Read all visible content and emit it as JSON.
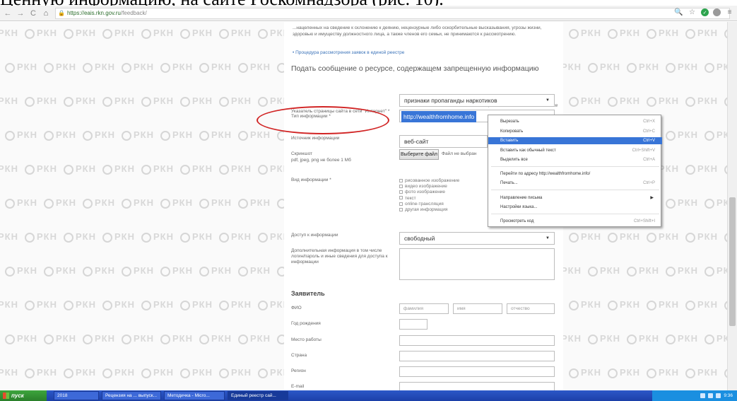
{
  "caption": "Ценную информацию, на сайте Роскомнадзора (рис. 10).",
  "browser": {
    "url_host": "https://eais.rkn.gov.ru",
    "url_path": "/feedback/",
    "back": "←",
    "forward": "→",
    "reload": "C",
    "home": "⌂"
  },
  "watermark": "РКН",
  "form": {
    "intro": "...нацеленных на сведение к склонению к деянию, нецензурные либо оскорбительные высказывания, угрозы жизни, здоровью и имуществу должностного лица, а также членов его семьи, не принимаются к рассмотрению.",
    "procedure_link": "Процедура рассмотрения заявок в единой реестре",
    "section_title": "Подать сообщение о ресурсе, содержащем запрещенную информацию",
    "required_note": "* - поля, обязательные для заполнения",
    "info_type_label": "Тип информации *",
    "info_type_value": "признаки пропаганды наркотиков",
    "url_label": "Указатель страницы сайта в сети \"Интернет\" *",
    "url_value": "http://wealthfromhome.info",
    "source_label": "Источник информации",
    "source_value": "веб-сайт",
    "screenshot_label": "Скриншот",
    "screenshot_hint": "pdf, jpeg, png не более 1 Мб",
    "file_button": "Выберите файл",
    "file_status": "Файл не выбран",
    "view_label": "Вид информации *",
    "view_options": [
      "рисованное изображение",
      "видео изображение",
      "фото изображение",
      "текст",
      "online-трансляция",
      "другая информация"
    ],
    "access_label": "Доступ к информации",
    "access_value": "свободный",
    "extra_label": "Дополнительная информация в том числе логин/пароль и иные сведения для доступа к информации",
    "applicant_title": "Заявитель",
    "fio_label": "ФИО",
    "fio_placeholders": [
      "фамилия",
      "имя",
      "отчество"
    ],
    "birth_label": "Год рождения",
    "work_label": "Место работы",
    "country_label": "Страна",
    "region_label": "Регион",
    "email_label": "E-mail"
  },
  "context_menu": [
    {
      "label": "Вырезать",
      "shortcut": "Ctrl+X"
    },
    {
      "label": "Копировать",
      "shortcut": "Ctrl+C"
    },
    {
      "label": "Вставить",
      "shortcut": "Ctrl+V"
    },
    {
      "label": "Вставить как обычный текст",
      "shortcut": "Ctrl+Shift+V"
    },
    {
      "label": "Выделить все",
      "shortcut": "Ctrl+A"
    },
    {
      "label": "Перейти по адресу http://wealthfromhome.info/",
      "shortcut": ""
    },
    {
      "label": "Печать...",
      "shortcut": "Ctrl+P"
    },
    {
      "label": "Направление письма",
      "shortcut": ""
    },
    {
      "label": "Настройки языка...",
      "shortcut": ""
    },
    {
      "label": "Просмотреть код",
      "shortcut": "Ctrl+Shift+I"
    }
  ],
  "taskbar": {
    "start": "пуск",
    "tasks": [
      "2018",
      "Рецензия на ... выпуск...",
      "Методичка - Micro...",
      "Единый реестр сай..."
    ],
    "clock": "9:36"
  }
}
